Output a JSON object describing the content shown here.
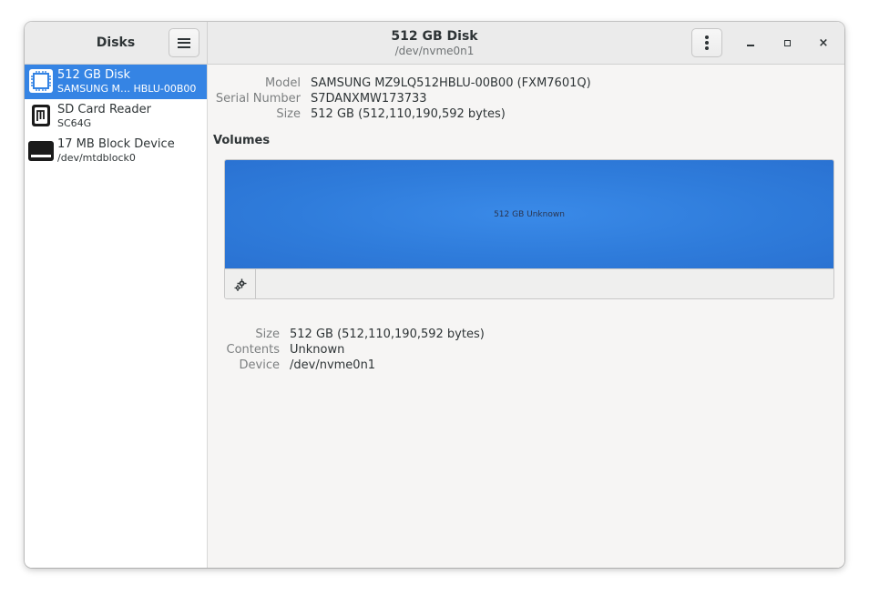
{
  "app": {
    "title": "Disks"
  },
  "header": {
    "disk_title": "512 GB Disk",
    "disk_subtitle": "/dev/nvme0n1",
    "close_glyph": "×"
  },
  "sidebar": {
    "items": [
      {
        "name": "512 GB Disk",
        "sub": "SAMSUNG M…  HBLU-00B00",
        "icon": "ssd-chip-icon",
        "selected": true
      },
      {
        "name": "SD Card Reader",
        "sub": "SC64G",
        "icon": "sd-card-icon",
        "selected": false
      },
      {
        "name": "17 MB Block Device",
        "sub": "/dev/mtdblock0",
        "icon": "block-device-icon",
        "selected": false
      }
    ]
  },
  "disk_info": {
    "model_label": "Model",
    "model_value": "SAMSUNG MZ9LQ512HBLU-00B00 (FXM7601Q)",
    "serial_label": "Serial Number",
    "serial_value": "S7DANXMW173733",
    "size_label": "Size",
    "size_value": "512 GB (512,110,190,592 bytes)"
  },
  "volumes": {
    "heading": "Volumes",
    "partition_label": "512 GB Unknown",
    "partition_color": "#3584e4"
  },
  "volume_info": {
    "size_label": "Size",
    "size_value": "512 GB (512,110,190,592 bytes)",
    "contents_label": "Contents",
    "contents_value": "Unknown",
    "device_label": "Device",
    "device_value": "/dev/nvme0n1"
  },
  "colors": {
    "accent": "#3584e4",
    "header_bg": "#ebebeb",
    "content_bg": "#f6f5f4"
  }
}
